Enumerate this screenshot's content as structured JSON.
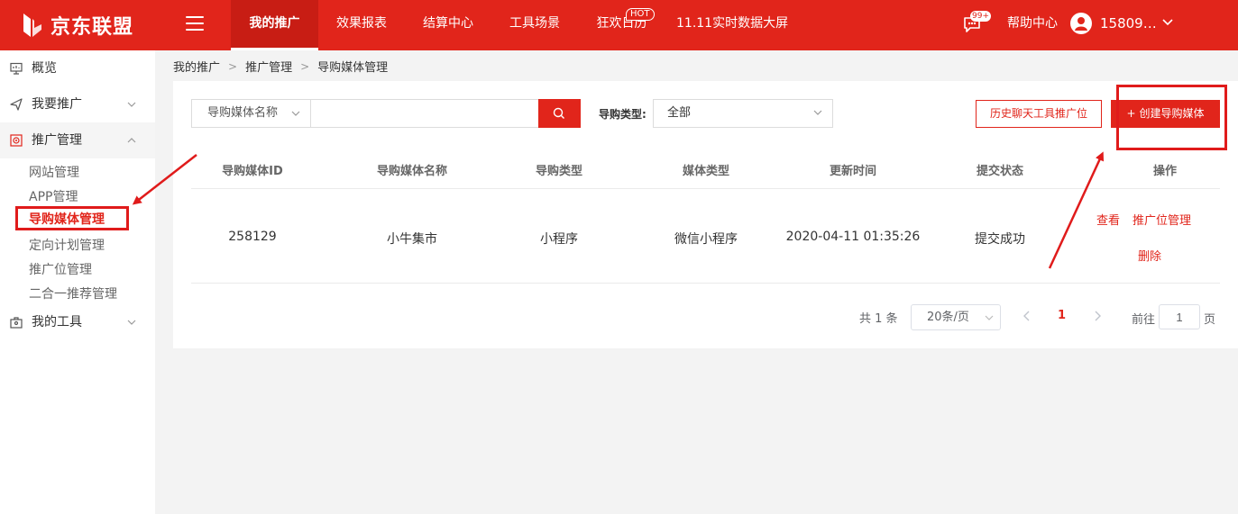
{
  "header": {
    "logo_text": "京东联盟",
    "nav": [
      {
        "label": "我的推广",
        "active": true
      },
      {
        "label": "效果报表"
      },
      {
        "label": "结算中心"
      },
      {
        "label": "工具场景"
      },
      {
        "label": "狂欢日历",
        "badge": "HOT"
      },
      {
        "label": "11.11实时数据大屏"
      }
    ],
    "message_badge": "99+",
    "help_label": "帮助中心",
    "username": "15809…",
    "brand_color": "#e1251b"
  },
  "sidebar": {
    "items": [
      {
        "label": "概览",
        "icon": "monitor-icon"
      },
      {
        "label": "我要推广",
        "icon": "send-icon"
      },
      {
        "label": "推广管理",
        "icon": "target-icon"
      },
      {
        "label": "我的工具",
        "icon": "toolbox-icon"
      }
    ],
    "sub_items": [
      "网站管理",
      "APP管理",
      "导购媒体管理",
      "定向计划管理",
      "推广位管理",
      "二合一推荐管理"
    ],
    "active_sub": "导购媒体管理"
  },
  "breadcrumb": [
    "我的推广",
    "推广管理",
    "导购媒体管理"
  ],
  "filters": {
    "search_field": "导购媒体名称",
    "search_value": "",
    "type_label": "导购类型:",
    "type_value": "全部"
  },
  "actions": {
    "history_label": "历史聊天工具推广位",
    "create_label": "创建导购媒体",
    "create_prefix": "+"
  },
  "table": {
    "columns": [
      "导购媒体ID",
      "导购媒体名称",
      "导购类型",
      "媒体类型",
      "更新时间",
      "提交状态",
      "操作"
    ],
    "rows": [
      {
        "id": "258129",
        "name": "小牛集市",
        "guide_type": "小程序",
        "media_type": "微信小程序",
        "updated": "2020-04-11 01:35:26",
        "status": "提交成功",
        "ops": [
          "查看",
          "推广位管理",
          "删除"
        ]
      }
    ]
  },
  "pagination": {
    "total_text": "共 1 条",
    "page_size": "20条/页",
    "current_page": "1",
    "goto_label": "前往",
    "goto_value": "1",
    "page_suffix": "页"
  }
}
